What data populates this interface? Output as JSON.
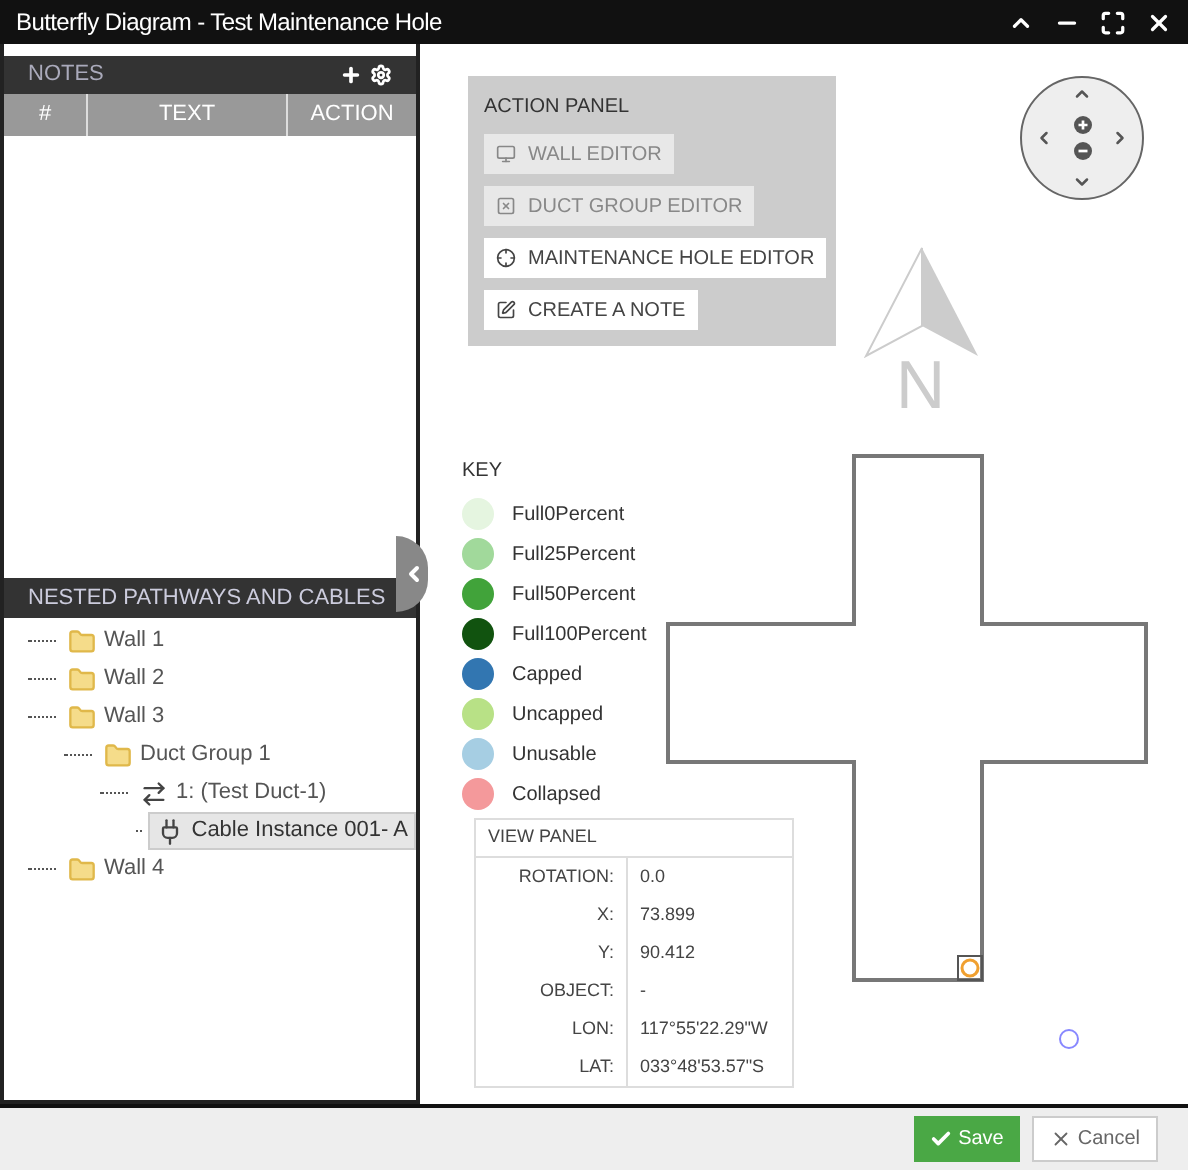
{
  "window": {
    "title": "Butterfly Diagram - Test Maintenance Hole"
  },
  "notes": {
    "title": "NOTES",
    "columns": [
      "#",
      "TEXT",
      "ACTION"
    ]
  },
  "tree": {
    "title": "NESTED PATHWAYS AND CABLES",
    "items": [
      {
        "label": "Wall 1",
        "kind": "folder",
        "selected": false
      },
      {
        "label": "Wall 2",
        "kind": "folder",
        "selected": false
      },
      {
        "label": "Wall 3",
        "kind": "folder",
        "selected": false,
        "expanded": true,
        "children": [
          {
            "label": "Duct Group 1",
            "kind": "folder",
            "selected": false,
            "expanded": true,
            "children": [
              {
                "label": "1: (Test Duct-1)",
                "kind": "duct",
                "selected": false,
                "expanded": true,
                "children": [
                  {
                    "label": "Cable Instance 001- A",
                    "kind": "cable",
                    "selected": true
                  }
                ]
              }
            ]
          }
        ]
      },
      {
        "label": "Wall 4",
        "kind": "folder",
        "selected": false
      }
    ]
  },
  "action_panel": {
    "title": "ACTION PANEL",
    "buttons": [
      {
        "label": "WALL EDITOR",
        "kind": "wall",
        "disabled": true
      },
      {
        "label": "DUCT GROUP EDITOR",
        "kind": "duct",
        "disabled": true
      },
      {
        "label": "MAINTENANCE HOLE EDITOR",
        "kind": "hole",
        "disabled": false
      },
      {
        "label": "CREATE A NOTE",
        "kind": "note",
        "disabled": false
      }
    ]
  },
  "north_label": "N",
  "key": {
    "title": "KEY",
    "items": [
      {
        "label": "Full0Percent",
        "color": "#e5f5e0"
      },
      {
        "label": "Full25Percent",
        "color": "#a1d99b"
      },
      {
        "label": "Full50Percent",
        "color": "#41a33a"
      },
      {
        "label": "Full100Percent",
        "color": "#11530f"
      },
      {
        "label": "Capped",
        "color": "#3276b1"
      },
      {
        "label": "Uncapped",
        "color": "#b8e186"
      },
      {
        "label": "Unusable",
        "color": "#a6cee3"
      },
      {
        "label": "Collapsed",
        "color": "#f4999b"
      }
    ]
  },
  "view_panel": {
    "title": "VIEW PANEL",
    "rows": [
      {
        "label": "ROTATION:",
        "value": "0.0"
      },
      {
        "label": "X:",
        "value": "73.899"
      },
      {
        "label": "Y:",
        "value": "90.412"
      },
      {
        "label": "OBJECT:",
        "value": "-"
      },
      {
        "label": "LON:",
        "value": "117°55'22.29\"W"
      },
      {
        "label": "LAT:",
        "value": "033°48'53.57\"S"
      }
    ]
  },
  "footer": {
    "save": "Save",
    "cancel": "Cancel"
  }
}
